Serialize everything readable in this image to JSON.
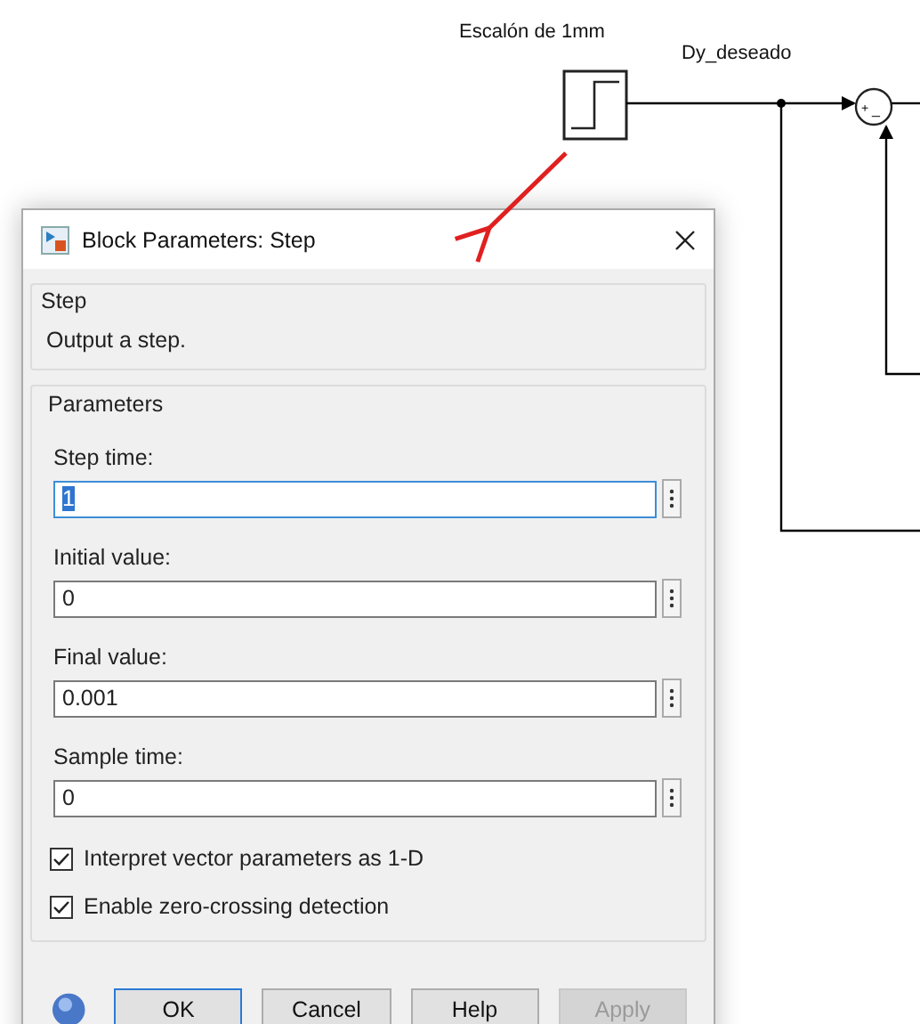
{
  "diagram": {
    "block_label": "Escalón de 1mm",
    "signal_label": "Dy_deseado",
    "sum_signs": [
      "+",
      "_"
    ]
  },
  "dialog": {
    "title": "Block Parameters: Step",
    "block_group": {
      "title": "Step",
      "description": "Output a step."
    },
    "parameters": {
      "title": "Parameters",
      "fields": [
        {
          "label": "Step time:",
          "value": "1",
          "value_selected": true
        },
        {
          "label": "Initial value:",
          "value": "0",
          "value_selected": false
        },
        {
          "label": "Final value:",
          "value": "0.001",
          "value_selected": false
        },
        {
          "label": "Sample time:",
          "value": "0",
          "value_selected": false
        }
      ],
      "checkboxes": [
        {
          "label": "Interpret vector parameters as 1-D",
          "checked": true
        },
        {
          "label": "Enable zero-crossing detection",
          "checked": true
        }
      ]
    },
    "buttons": [
      {
        "label": "OK",
        "default": true,
        "disabled": false
      },
      {
        "label": "Cancel",
        "default": false,
        "disabled": false
      },
      {
        "label": "Help",
        "default": false,
        "disabled": false
      },
      {
        "label": "Apply",
        "default": false,
        "disabled": true
      }
    ]
  }
}
